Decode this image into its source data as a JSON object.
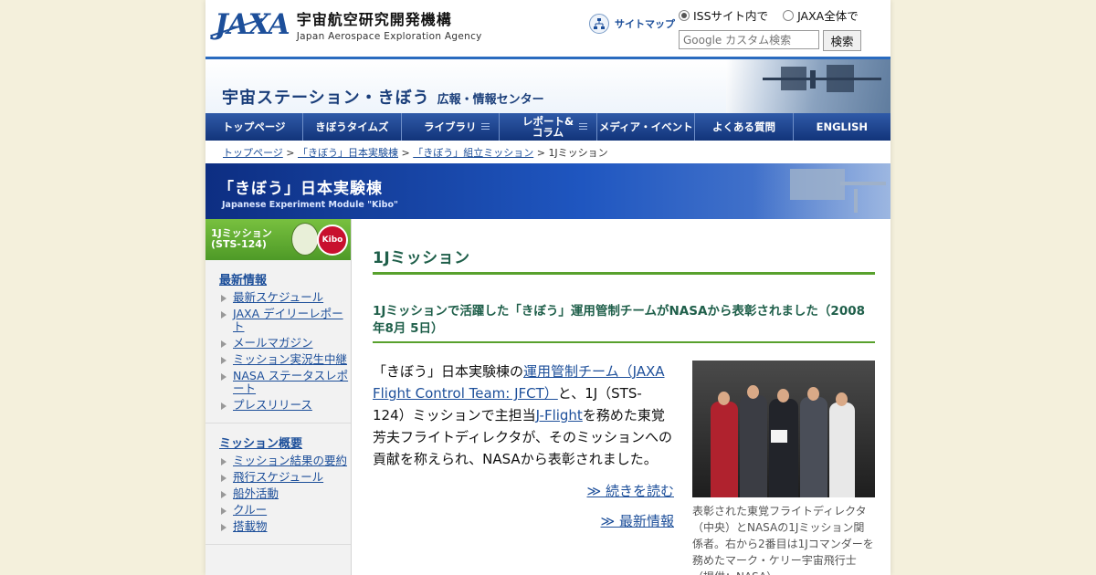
{
  "header": {
    "logo_mark": "JAXA",
    "org_name_jp": "宇宙航空研究開発機構",
    "org_name_en": "Japan Aerospace Exploration Agency",
    "sitemap_label": "サイトマップ",
    "search": {
      "option_iss": "ISSサイト内で",
      "option_jaxa": "JAXA全体で",
      "selected": "ISSサイト内で",
      "placeholder": "Google カスタム検索",
      "button": "検索"
    }
  },
  "banner": {
    "title": "宇宙ステーション・きぼう",
    "subtitle": "広報・情報センター"
  },
  "nav": {
    "items": [
      {
        "label": "トップページ"
      },
      {
        "label": "きぼうタイムズ"
      },
      {
        "label": "ライブラリ"
      },
      {
        "label": "レポート&コラム"
      },
      {
        "label": "メディア・イベント"
      },
      {
        "label": "よくある質問"
      },
      {
        "label": "ENGLISH"
      }
    ]
  },
  "breadcrumb": {
    "items": [
      "トップページ",
      "「きぼう」日本実験棟",
      "「きぼう」組立ミッション"
    ],
    "current": "1Jミッション",
    "separator": " > "
  },
  "section_band": {
    "title_jp": "「きぼう」日本実験棟",
    "title_en": "Japanese Experiment Module \"Kibo\""
  },
  "sidebar": {
    "mission_banner": {
      "line1": "1Jミッション",
      "line2": "(STS-124)",
      "badge": "Kibo"
    },
    "sections": [
      {
        "title": "最新情報",
        "items": [
          "最新スケジュール",
          "JAXA デイリーレポート",
          "メールマガジン",
          "ミッション実況生中継",
          "NASA ステータスレポート",
          "プレスリリース"
        ]
      },
      {
        "title": "ミッション概要",
        "items": [
          "ミッション結果の要約",
          "飛行スケジュール",
          "船外活動",
          "クルー",
          "搭載物"
        ]
      }
    ]
  },
  "main": {
    "page_title": "1Jミッション",
    "article_title": "1Jミッションで活躍した「きぼう」運用管制チームがNASAから表彰されました（2008年8月 5日）",
    "body": {
      "t1": "「きぼう」日本実験棟の",
      "link1": "運用管制チーム（JAXA Flight Control Team: JFCT）",
      "t2": "と、1J（STS-124）ミッションで主担当",
      "link2": "J-Flight",
      "t3": "を務めた東覚芳夫フライトディレクタが、そのミッションへの貢献を称えられ、NASAから表彰されました。"
    },
    "read_more": "≫ 続きを読む",
    "latest_news": "≫ 最新情報",
    "photo_caption": "表彰された東覚フライトディレクタ（中央）とNASAの1Jミッション関係者。右から2番目は1Jコマンダーを務めたマーク・ケリー宇宙飛行士（提供：NASA）"
  },
  "colors": {
    "page_bg": "#f4f0dc",
    "nav_blue": "#12347a",
    "link_blue": "#1d4f9a",
    "heading_green": "#1f5f4a",
    "rule_green": "#58a12d"
  }
}
